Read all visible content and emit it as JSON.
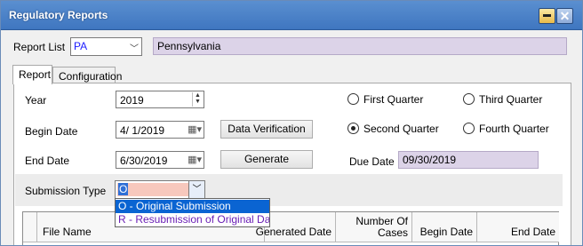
{
  "window": {
    "title": "Regulatory Reports"
  },
  "report_list": {
    "label": "Report List",
    "value": "PA",
    "state_name": "Pennsylvania"
  },
  "tabs": [
    {
      "label": "Report"
    },
    {
      "label": "Configuration"
    }
  ],
  "form": {
    "year_label": "Year",
    "year_value": "2019",
    "begin_date_label": "Begin Date",
    "begin_date_value": "4/ 1/2019",
    "end_date_label": "End Date",
    "end_date_value": "6/30/2019",
    "data_verification_button": "Data Verification",
    "generate_button": "Generate",
    "due_date_label": "Due Date",
    "due_date_value": "09/30/2019",
    "submission_type_label": "Submission Type",
    "submission_type_value": "O"
  },
  "quarters": [
    {
      "label": "First Quarter",
      "checked": false
    },
    {
      "label": "Third Quarter",
      "checked": false
    },
    {
      "label": "Second Quarter",
      "checked": true
    },
    {
      "label": "Fourth Quarter",
      "checked": false
    }
  ],
  "submission_options": [
    "O - Original Submission",
    "R - Resubmission of Original Dat"
  ],
  "table": {
    "columns": [
      "File Name",
      "Generated Date",
      "Number Of Cases",
      "Begin Date",
      "End Date"
    ]
  }
}
